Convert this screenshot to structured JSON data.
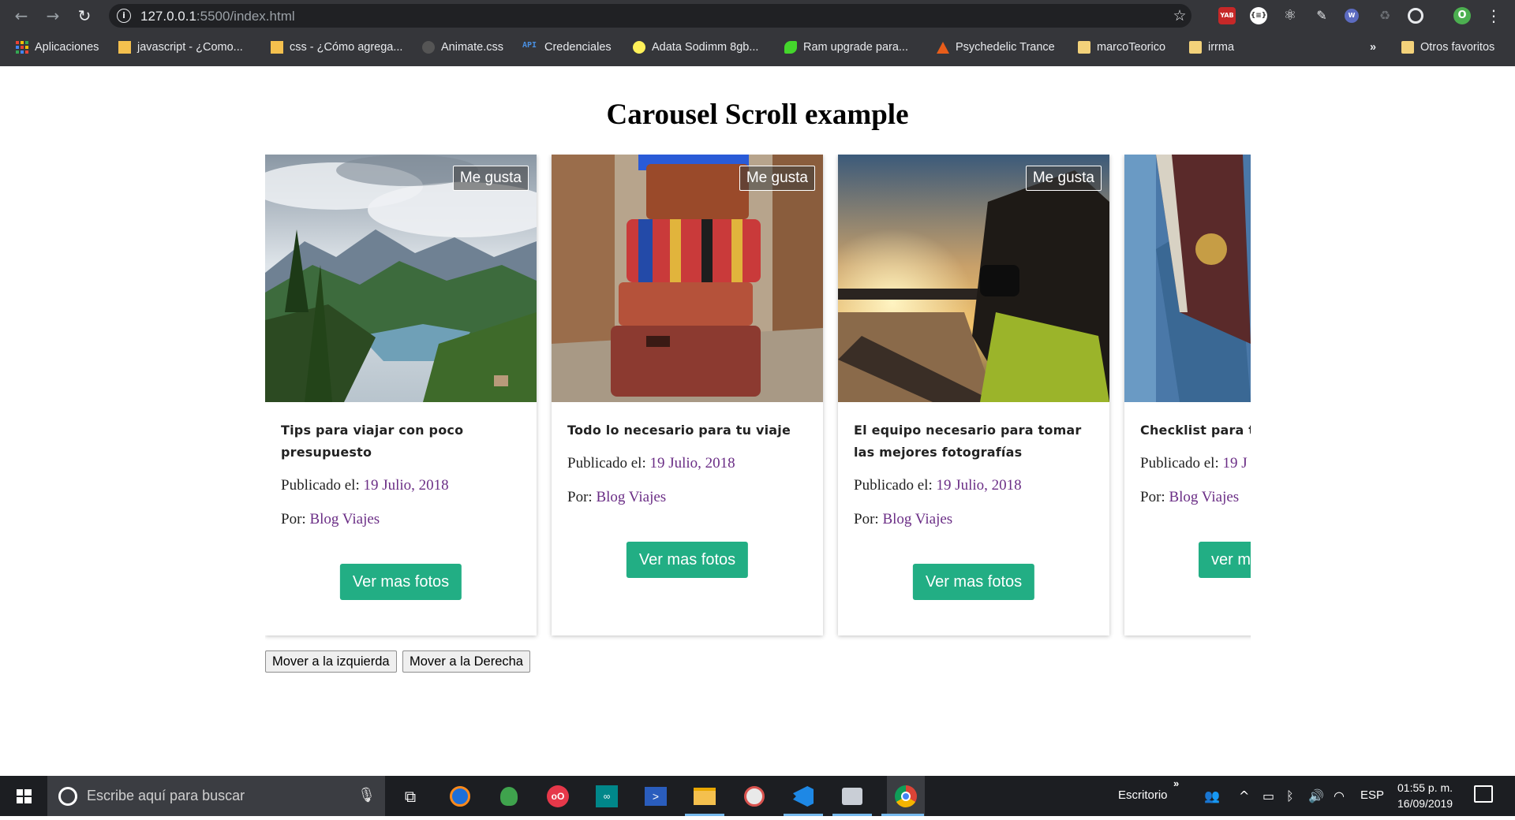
{
  "browser": {
    "url_host": "127.0.0.1",
    "url_path": ":5500/index.html",
    "bookmarks": [
      {
        "label": "Aplicaciones",
        "icon": "apps-grid-icon"
      },
      {
        "label": "javascript - ¿Como...",
        "icon": "stackoverflow-icon"
      },
      {
        "label": "css - ¿Cómo agrega...",
        "icon": "stackoverflow-icon"
      },
      {
        "label": "Animate.css",
        "icon": "animate-icon"
      },
      {
        "label": "Credenciales",
        "icon": "api-icon"
      },
      {
        "label": "Adata Sodimm 8gb...",
        "icon": "mercadolibre-icon"
      },
      {
        "label": "Ram upgrade para...",
        "icon": "razer-icon"
      },
      {
        "label": "Psychedelic Trance",
        "icon": "triangle-icon"
      },
      {
        "label": "marcoTeorico",
        "icon": "folder-icon"
      },
      {
        "label": "irrma",
        "icon": "folder-icon"
      },
      {
        "label": "Otros favoritos",
        "icon": "folder-icon"
      }
    ],
    "more_bookmarks": "»",
    "profile_initial": "O"
  },
  "page": {
    "title": "Carousel Scroll example",
    "cards": [
      {
        "title": "Tips para viajar con poco presupuesto",
        "like_label": "Me gusta",
        "published_label": "Publicado el:",
        "date": "19 Julio, 2018",
        "by_label": "Por:",
        "author": "Blog Viajes",
        "button_label": "Ver mas fotos",
        "image": "mountain-lake-photo"
      },
      {
        "title": "Todo lo necesario para tu viaje",
        "like_label": "Me gusta",
        "published_label": "Publicado el:",
        "date": "19 Julio, 2018",
        "by_label": "Por:",
        "author": "Blog Viajes",
        "button_label": "Ver mas fotos",
        "image": "stacked-suitcases-photo"
      },
      {
        "title": "El equipo necesario para tomar las mejores fotografías",
        "like_label": "Me gusta",
        "published_label": "Publicado el:",
        "date": "19 Julio, 2018",
        "by_label": "Por:",
        "author": "Blog Viajes",
        "button_label": "Ver mas fotos",
        "image": "photographer-sunset-photo"
      },
      {
        "title": "Checklist para tu",
        "like_label": "",
        "published_label": "Publicado el:",
        "date": "19 J",
        "by_label": "Por:",
        "author": "Blog Viajes",
        "button_label": "ver m",
        "image": "passport-denim-photo"
      }
    ],
    "left_button": "Mover a la izquierda",
    "right_button": "Mover a la Derecha"
  },
  "taskbar": {
    "search_placeholder": "Escribe aquí para buscar",
    "desktop_label": "Escritorio",
    "language": "ESP",
    "time": "01:55 p. m.",
    "date": "16/09/2019"
  },
  "colors": {
    "accent_button": "#22ae84",
    "link": "#6b2e86",
    "chrome_bg": "#35363a",
    "taskbar_bg": "#1c1e22"
  }
}
